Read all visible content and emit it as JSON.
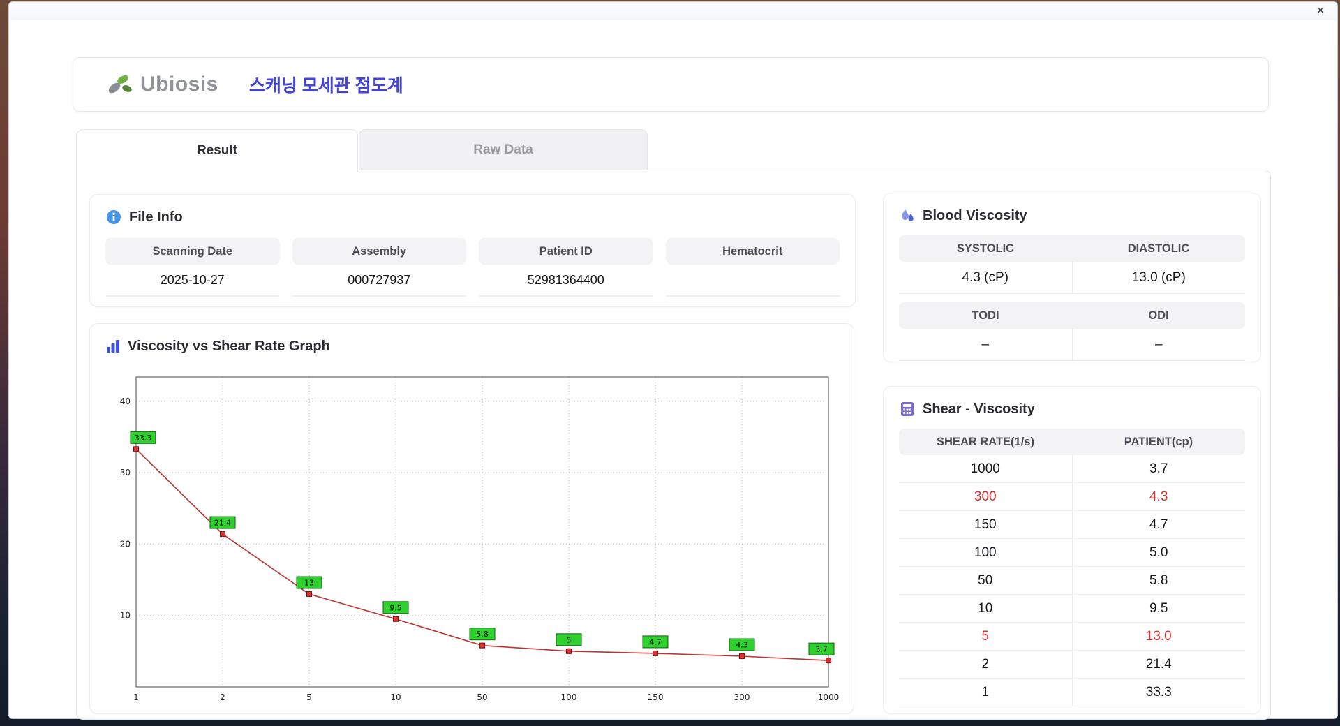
{
  "window": {
    "close_icon": "✕"
  },
  "header": {
    "logo": "Ubiosis",
    "title": "스캐닝 모세관 점도계"
  },
  "tabs": [
    {
      "label": "Result",
      "active": true
    },
    {
      "label": "Raw Data",
      "active": false
    }
  ],
  "file_info": {
    "title": "File Info",
    "fields": [
      {
        "label": "Scanning Date",
        "value": "2025-10-27"
      },
      {
        "label": "Assembly",
        "value": "000727937"
      },
      {
        "label": "Patient ID",
        "value": "52981364400"
      },
      {
        "label": "Hematocrit",
        "value": ""
      }
    ]
  },
  "graph_card": {
    "title": "Viscosity vs Shear Rate Graph"
  },
  "blood_viscosity": {
    "title": "Blood Viscosity",
    "cells": [
      {
        "label": "SYSTOLIC",
        "value": "4.3 (cP)"
      },
      {
        "label": "DIASTOLIC",
        "value": "13.0 (cP)"
      },
      {
        "label": "TODI",
        "value": "–"
      },
      {
        "label": "ODI",
        "value": "–"
      }
    ]
  },
  "shear_viscosity": {
    "title": "Shear - Viscosity",
    "columns": [
      "SHEAR RATE(1/s)",
      "PATIENT(cp)"
    ],
    "rows": [
      {
        "shear_rate": "1000",
        "patient": "3.7",
        "highlight": false
      },
      {
        "shear_rate": "300",
        "patient": "4.3",
        "highlight": true
      },
      {
        "shear_rate": "150",
        "patient": "4.7",
        "highlight": false
      },
      {
        "shear_rate": "100",
        "patient": "5.0",
        "highlight": false
      },
      {
        "shear_rate": "50",
        "patient": "5.8",
        "highlight": false
      },
      {
        "shear_rate": "10",
        "patient": "9.5",
        "highlight": false
      },
      {
        "shear_rate": "5",
        "patient": "13.0",
        "highlight": true
      },
      {
        "shear_rate": "2",
        "patient": "21.4",
        "highlight": false
      },
      {
        "shear_rate": "1",
        "patient": "33.3",
        "highlight": false
      }
    ]
  },
  "chart_data": {
    "type": "line",
    "title": "Viscosity vs Shear Rate Graph",
    "x": [
      1,
      2,
      5,
      10,
      50,
      100,
      150,
      300,
      1000
    ],
    "x_tick_labels": [
      "1",
      "2",
      "5",
      "10",
      "50",
      "100",
      "150",
      "300",
      "1000"
    ],
    "x_scale": "categorical-even-spacing",
    "series": [
      {
        "name": "patient_viscosity_cP",
        "values": [
          33.3,
          21.4,
          13,
          9.5,
          5.8,
          5,
          4.7,
          4.3,
          3.7
        ]
      }
    ],
    "point_labels": [
      "33.3",
      "21.4",
      "13",
      "9.5",
      "5.8",
      "5",
      "4.7",
      "4.3",
      "3.7"
    ],
    "y_ticks": [
      10,
      20,
      30,
      40
    ],
    "ylim": [
      0,
      43.4
    ],
    "grid": true,
    "legend": false,
    "line_color": "#bd3430",
    "marker_color": "#e03030",
    "label_bg": "#2ed12e"
  },
  "colors": {
    "accent_title_blue": "#4343df",
    "info_icon_blue": "#4596e6",
    "bar_icon_blue": "#3f51d6",
    "droplet_purple": "#5f6fd8",
    "calc_purple": "#7a6ad8",
    "highlight_red": "#d9302c",
    "header_gray_bg": "#f3f3f6",
    "logo_green": "#6fb043",
    "logo_gray": "#8f9296"
  }
}
